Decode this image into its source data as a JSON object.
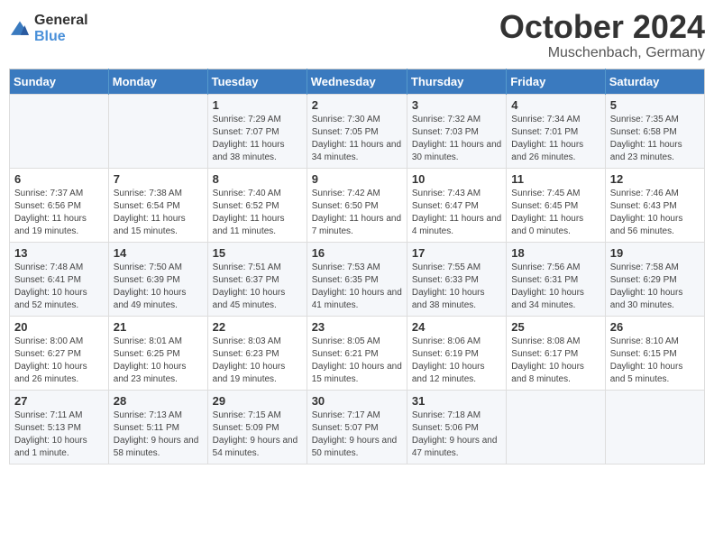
{
  "logo": {
    "general": "General",
    "blue": "Blue"
  },
  "title": "October 2024",
  "location": "Muschenbach, Germany",
  "days_of_week": [
    "Sunday",
    "Monday",
    "Tuesday",
    "Wednesday",
    "Thursday",
    "Friday",
    "Saturday"
  ],
  "weeks": [
    [
      {
        "day": "",
        "sunrise": "",
        "sunset": "",
        "daylight": ""
      },
      {
        "day": "",
        "sunrise": "",
        "sunset": "",
        "daylight": ""
      },
      {
        "day": "1",
        "sunrise": "Sunrise: 7:29 AM",
        "sunset": "Sunset: 7:07 PM",
        "daylight": "Daylight: 11 hours and 38 minutes."
      },
      {
        "day": "2",
        "sunrise": "Sunrise: 7:30 AM",
        "sunset": "Sunset: 7:05 PM",
        "daylight": "Daylight: 11 hours and 34 minutes."
      },
      {
        "day": "3",
        "sunrise": "Sunrise: 7:32 AM",
        "sunset": "Sunset: 7:03 PM",
        "daylight": "Daylight: 11 hours and 30 minutes."
      },
      {
        "day": "4",
        "sunrise": "Sunrise: 7:34 AM",
        "sunset": "Sunset: 7:01 PM",
        "daylight": "Daylight: 11 hours and 26 minutes."
      },
      {
        "day": "5",
        "sunrise": "Sunrise: 7:35 AM",
        "sunset": "Sunset: 6:58 PM",
        "daylight": "Daylight: 11 hours and 23 minutes."
      }
    ],
    [
      {
        "day": "6",
        "sunrise": "Sunrise: 7:37 AM",
        "sunset": "Sunset: 6:56 PM",
        "daylight": "Daylight: 11 hours and 19 minutes."
      },
      {
        "day": "7",
        "sunrise": "Sunrise: 7:38 AM",
        "sunset": "Sunset: 6:54 PM",
        "daylight": "Daylight: 11 hours and 15 minutes."
      },
      {
        "day": "8",
        "sunrise": "Sunrise: 7:40 AM",
        "sunset": "Sunset: 6:52 PM",
        "daylight": "Daylight: 11 hours and 11 minutes."
      },
      {
        "day": "9",
        "sunrise": "Sunrise: 7:42 AM",
        "sunset": "Sunset: 6:50 PM",
        "daylight": "Daylight: 11 hours and 7 minutes."
      },
      {
        "day": "10",
        "sunrise": "Sunrise: 7:43 AM",
        "sunset": "Sunset: 6:47 PM",
        "daylight": "Daylight: 11 hours and 4 minutes."
      },
      {
        "day": "11",
        "sunrise": "Sunrise: 7:45 AM",
        "sunset": "Sunset: 6:45 PM",
        "daylight": "Daylight: 11 hours and 0 minutes."
      },
      {
        "day": "12",
        "sunrise": "Sunrise: 7:46 AM",
        "sunset": "Sunset: 6:43 PM",
        "daylight": "Daylight: 10 hours and 56 minutes."
      }
    ],
    [
      {
        "day": "13",
        "sunrise": "Sunrise: 7:48 AM",
        "sunset": "Sunset: 6:41 PM",
        "daylight": "Daylight: 10 hours and 52 minutes."
      },
      {
        "day": "14",
        "sunrise": "Sunrise: 7:50 AM",
        "sunset": "Sunset: 6:39 PM",
        "daylight": "Daylight: 10 hours and 49 minutes."
      },
      {
        "day": "15",
        "sunrise": "Sunrise: 7:51 AM",
        "sunset": "Sunset: 6:37 PM",
        "daylight": "Daylight: 10 hours and 45 minutes."
      },
      {
        "day": "16",
        "sunrise": "Sunrise: 7:53 AM",
        "sunset": "Sunset: 6:35 PM",
        "daylight": "Daylight: 10 hours and 41 minutes."
      },
      {
        "day": "17",
        "sunrise": "Sunrise: 7:55 AM",
        "sunset": "Sunset: 6:33 PM",
        "daylight": "Daylight: 10 hours and 38 minutes."
      },
      {
        "day": "18",
        "sunrise": "Sunrise: 7:56 AM",
        "sunset": "Sunset: 6:31 PM",
        "daylight": "Daylight: 10 hours and 34 minutes."
      },
      {
        "day": "19",
        "sunrise": "Sunrise: 7:58 AM",
        "sunset": "Sunset: 6:29 PM",
        "daylight": "Daylight: 10 hours and 30 minutes."
      }
    ],
    [
      {
        "day": "20",
        "sunrise": "Sunrise: 8:00 AM",
        "sunset": "Sunset: 6:27 PM",
        "daylight": "Daylight: 10 hours and 26 minutes."
      },
      {
        "day": "21",
        "sunrise": "Sunrise: 8:01 AM",
        "sunset": "Sunset: 6:25 PM",
        "daylight": "Daylight: 10 hours and 23 minutes."
      },
      {
        "day": "22",
        "sunrise": "Sunrise: 8:03 AM",
        "sunset": "Sunset: 6:23 PM",
        "daylight": "Daylight: 10 hours and 19 minutes."
      },
      {
        "day": "23",
        "sunrise": "Sunrise: 8:05 AM",
        "sunset": "Sunset: 6:21 PM",
        "daylight": "Daylight: 10 hours and 15 minutes."
      },
      {
        "day": "24",
        "sunrise": "Sunrise: 8:06 AM",
        "sunset": "Sunset: 6:19 PM",
        "daylight": "Daylight: 10 hours and 12 minutes."
      },
      {
        "day": "25",
        "sunrise": "Sunrise: 8:08 AM",
        "sunset": "Sunset: 6:17 PM",
        "daylight": "Daylight: 10 hours and 8 minutes."
      },
      {
        "day": "26",
        "sunrise": "Sunrise: 8:10 AM",
        "sunset": "Sunset: 6:15 PM",
        "daylight": "Daylight: 10 hours and 5 minutes."
      }
    ],
    [
      {
        "day": "27",
        "sunrise": "Sunrise: 7:11 AM",
        "sunset": "Sunset: 5:13 PM",
        "daylight": "Daylight: 10 hours and 1 minute."
      },
      {
        "day": "28",
        "sunrise": "Sunrise: 7:13 AM",
        "sunset": "Sunset: 5:11 PM",
        "daylight": "Daylight: 9 hours and 58 minutes."
      },
      {
        "day": "29",
        "sunrise": "Sunrise: 7:15 AM",
        "sunset": "Sunset: 5:09 PM",
        "daylight": "Daylight: 9 hours and 54 minutes."
      },
      {
        "day": "30",
        "sunrise": "Sunrise: 7:17 AM",
        "sunset": "Sunset: 5:07 PM",
        "daylight": "Daylight: 9 hours and 50 minutes."
      },
      {
        "day": "31",
        "sunrise": "Sunrise: 7:18 AM",
        "sunset": "Sunset: 5:06 PM",
        "daylight": "Daylight: 9 hours and 47 minutes."
      },
      {
        "day": "",
        "sunrise": "",
        "sunset": "",
        "daylight": ""
      },
      {
        "day": "",
        "sunrise": "",
        "sunset": "",
        "daylight": ""
      }
    ]
  ]
}
